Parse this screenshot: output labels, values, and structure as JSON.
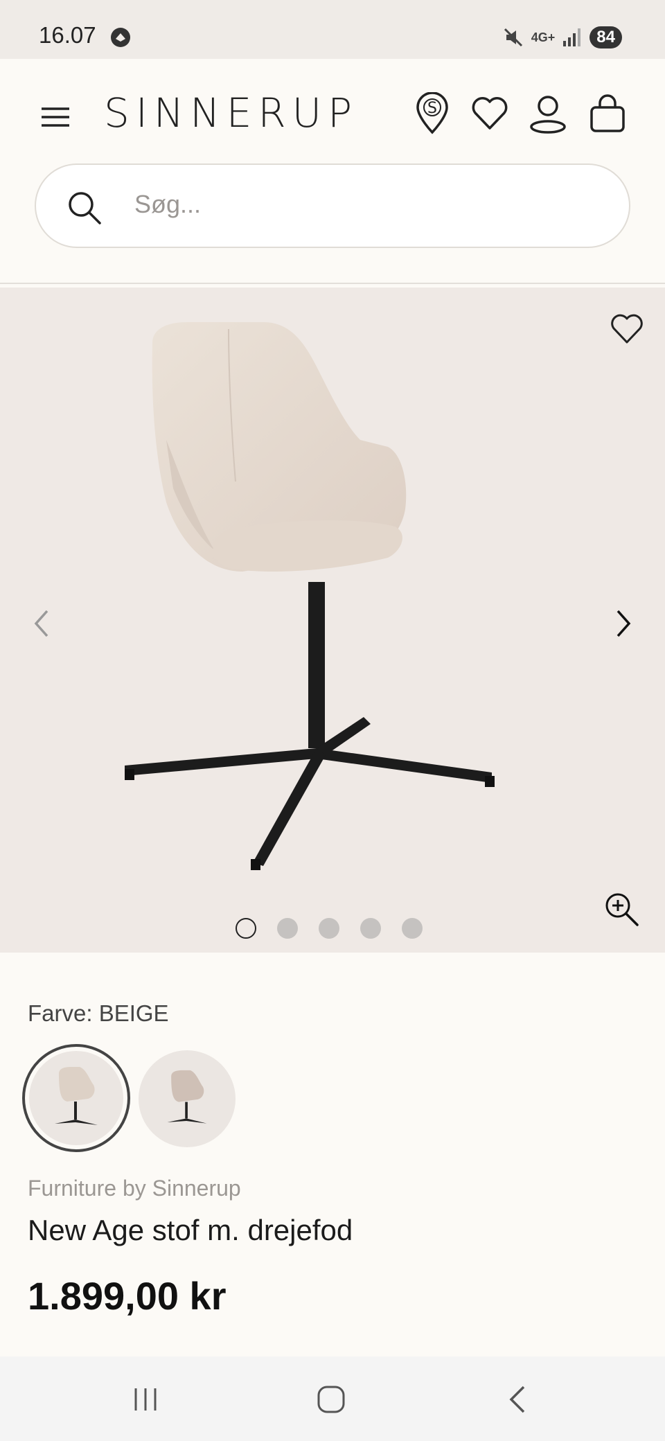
{
  "status_bar": {
    "time": "16.07",
    "network": "4G+",
    "battery": "84"
  },
  "header": {
    "logo": "SINNERUP",
    "icons": [
      "menu-icon",
      "store-locator-icon",
      "wishlist-icon",
      "account-icon",
      "cart-icon"
    ]
  },
  "search": {
    "placeholder": "Søg..."
  },
  "gallery": {
    "image_count": 5,
    "active_index": 0
  },
  "product": {
    "color_label": "Farve: BEIGE",
    "swatches": [
      "BEIGE",
      "alternate"
    ],
    "brand": "Furniture by Sinnerup",
    "name": "New Age stof m. drejefod",
    "price": "1.899,00 kr"
  },
  "colors": {
    "background": "#fcfaf6",
    "gallery_bg": "#efe9e5",
    "fabric": "#e8dcd2",
    "base": "#1c1c1c"
  }
}
